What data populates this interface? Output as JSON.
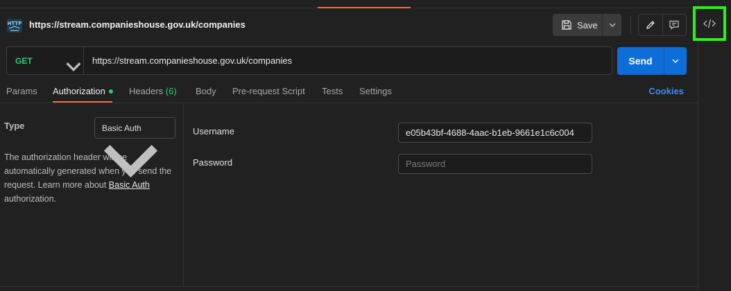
{
  "request": {
    "title": "https://stream.companieshouse.gov.uk/companies",
    "method": "GET",
    "url": "https://stream.companieshouse.gov.uk/companies"
  },
  "toolbar": {
    "save_label": "Save",
    "send_label": "Send"
  },
  "tabs": [
    {
      "label": "Params"
    },
    {
      "label": "Authorization"
    },
    {
      "label": "Headers",
      "count": "(6)"
    },
    {
      "label": "Body"
    },
    {
      "label": "Pre-request Script"
    },
    {
      "label": "Tests"
    },
    {
      "label": "Settings"
    }
  ],
  "cookies_label": "Cookies",
  "auth": {
    "type_label": "Type",
    "type_value": "Basic Auth",
    "description_pre": "The authorization header will be automatically generated when you send the request. Learn more about ",
    "description_link": "Basic Auth",
    "description_post": " authorization.",
    "username_label": "Username",
    "username_value": "e05b43bf-4688-4aac-b1eb-9661e1c6c004",
    "password_label": "Password",
    "password_placeholder": "Password"
  },
  "icons": {
    "http": "http-icon",
    "save": "save-icon",
    "edit": "pencil-icon",
    "comment": "comment-icon",
    "code": "code-icon"
  },
  "colors": {
    "accent": "#f26b3a",
    "send": "#0d6ed9",
    "get_method": "#2ecc71",
    "highlight": "#27f50f"
  }
}
